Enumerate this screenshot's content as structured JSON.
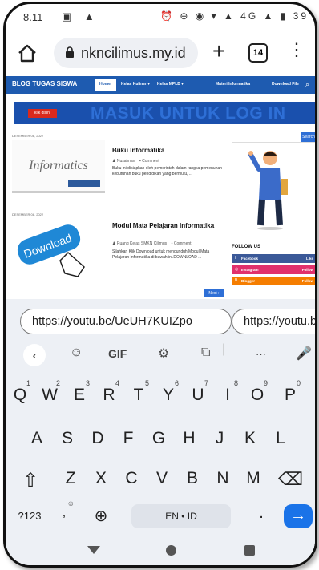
{
  "status": {
    "time": "8.11",
    "left_icons": "▣ ▲",
    "right_icons": "⏰ ⊖ ◉ ▾ ▲ 4G ▲ ▮ 39"
  },
  "browser": {
    "url": "nkncilimus.my.id",
    "tab_count": "14"
  },
  "site": {
    "brand": "BLOG TUGAS SISWA",
    "nav": [
      "Home",
      "Kelas Kuliner ▾",
      "Kelas MPLB ▾",
      "Materi Informatika",
      "Download File"
    ],
    "banner_button": "klik disini",
    "banner_text": "MASUK UNTUK LOG IN",
    "posts": [
      {
        "date": "DESEMBER 08, 2022",
        "title": "Buku Informatika",
        "author": "Nusaiman",
        "comment": "Comment",
        "excerpt": "Buku ini disiapkan oleh pemerintah dalam rangka pemenuhan kebutuhan buku pendidikan yang bermutu, ...",
        "thumb_word": "Informatics"
      },
      {
        "date": "DESEMBER 08, 2022",
        "title": "Modul Mata Pelajaran Informatika",
        "author": "Ruang Kelas SMKN Cilimus",
        "comment": "Comment",
        "excerpt": "Silahkan Klik Download untuk mengunduh Modul Mata Pelajaran Informatika di bawah ini.DOWNLOAD ...",
        "thumb_word": "Download"
      }
    ],
    "search_label": "Search",
    "follow_title": "FOLLOW US",
    "social": [
      {
        "name": "Facebook",
        "action": "Like",
        "color": "#3b5998"
      },
      {
        "name": "Instagram",
        "action": "Follow",
        "color": "#e1306c"
      },
      {
        "name": "Blogger",
        "action": "Follow",
        "color": "#f57d00"
      }
    ],
    "next_label": "Next ›"
  },
  "keyboard": {
    "suggestions": [
      "https://youtu.be/UeUH7KUIZpo",
      "https://youtu.b"
    ],
    "toolbar": [
      "‹",
      "☺",
      "GIF",
      "⚙",
      "⧉",
      "···",
      "🎤"
    ],
    "row1": [
      "Q",
      "W",
      "E",
      "R",
      "T",
      "Y",
      "U",
      "I",
      "O",
      "P"
    ],
    "row1_nums": [
      "1",
      "2",
      "3",
      "4",
      "5",
      "6",
      "7",
      "8",
      "9",
      "0"
    ],
    "row2": [
      "A",
      "S",
      "D",
      "F",
      "G",
      "H",
      "J",
      "K",
      "L"
    ],
    "row3": [
      "⇧",
      "Z",
      "X",
      "C",
      "V",
      "B",
      "N",
      "M",
      "⌫"
    ],
    "symbols": "?123",
    "comma": ",",
    "emoji_hint": "☺",
    "globe": "⊕",
    "space": "EN • ID",
    "period": ".",
    "enter": "→"
  }
}
